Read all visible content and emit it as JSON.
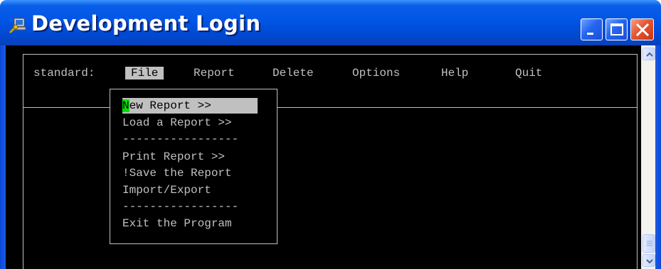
{
  "window": {
    "title": "Development Login",
    "icon": "computer-key-icon",
    "controls": [
      "minimize-icon",
      "maximize-icon",
      "close-icon"
    ]
  },
  "menubar": {
    "label": "standard:",
    "items": [
      {
        "label": "File",
        "active": true
      },
      {
        "label": "Report",
        "active": false
      },
      {
        "label": "Delete",
        "active": false
      },
      {
        "label": "Options",
        "active": false
      },
      {
        "label": "Help",
        "active": false
      },
      {
        "label": "Quit",
        "active": false
      }
    ]
  },
  "file_menu": {
    "items": [
      {
        "hotkey": "N",
        "rest": "ew Report >>",
        "selected": true
      },
      {
        "label": "Load a Report >>"
      },
      {
        "separator": "-----------------"
      },
      {
        "label": "Print Report >>"
      },
      {
        "label": "!Save the Report"
      },
      {
        "label": "Import/Export"
      },
      {
        "separator": "-----------------"
      },
      {
        "label": "Exit the Program"
      }
    ]
  },
  "scrollbar": {
    "icons": [
      "scroll-up-arrow-icon",
      "scroll-down-arrow-icon",
      "scroll-thumb-grip-icon"
    ]
  },
  "colors": {
    "titlebar": "#0055e5",
    "console_bg": "#000000",
    "console_fg": "#c0c0c0",
    "highlight": "#c0c0c0",
    "hotkey": "#00e000",
    "close_button": "#e65633"
  }
}
